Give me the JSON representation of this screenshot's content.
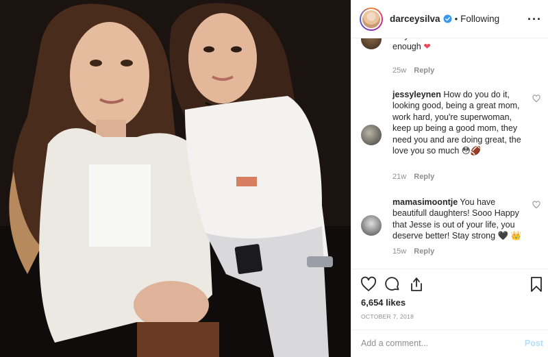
{
  "post": {
    "photo_alt": "",
    "colors": {
      "link": "#3897f0",
      "verified": "#3897f0",
      "heart_red": "#ed4956",
      "muted": "#8e8e8e",
      "post_disabled": "#b2dffc"
    }
  },
  "header": {
    "username": "darceysilva",
    "separator": "•",
    "follow_status": "Following",
    "more_icon": "more-horizontal-icon",
    "more_glyph": "···"
  },
  "comments": [
    {
      "user": "",
      "text": "they'll be of on their own soon enough",
      "emoji": "❤",
      "age": "25w",
      "reply_label": "Reply"
    },
    {
      "user": "jessyleynen",
      "text": "How do you do it, looking good, being a great mom, work hard, you're superwoman, keep up being a good mom, they need you and are doing great, the love you so much",
      "emoji": "😳🏈",
      "age": "21w",
      "reply_label": "Reply"
    },
    {
      "user": "mamasimoontje",
      "text": "You have beautifull daughters! Sooo Happy that Jesse is out of your life, you deserve better! Stay strong",
      "emoji": "🖤 👑",
      "age": "15w",
      "reply_label": "Reply"
    }
  ],
  "actions": {
    "like_icon": "heart-icon",
    "comment_icon": "comment-icon",
    "share_icon": "share-icon",
    "save_icon": "bookmark-icon"
  },
  "likes": "6,654 likes",
  "date": "OCTOBER 7, 2018",
  "add_comment": {
    "placeholder": "Add a comment...",
    "post_label": "Post"
  }
}
